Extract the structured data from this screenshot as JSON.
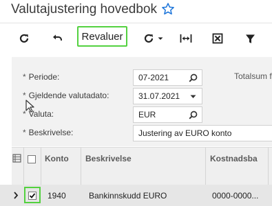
{
  "header": {
    "title": "Valutajustering hovedbok",
    "favorite_icon": "star-outline-icon"
  },
  "toolbar": {
    "refresh_icon": "refresh-icon",
    "undo_icon": "undo-icon",
    "revalue_label": "Revaluer",
    "actions_icon": "gear-refresh-icon",
    "fit_icon": "fit-columns-icon",
    "excel_icon": "export-excel-icon",
    "filter_icon": "filter-icon",
    "accent_color": "#53d13f"
  },
  "form": {
    "period": {
      "label": "Periode:",
      "value": "07-2021"
    },
    "rate_date": {
      "label": "Gjeldende valutadato:",
      "value": "31.07.2021"
    },
    "currency": {
      "label": "Valuta:",
      "value": "EUR"
    },
    "description": {
      "label": "Beskrivelse:",
      "value": "Justering av EURO konto"
    },
    "total_label": "Totalsum f",
    "required_mark": "*"
  },
  "grid": {
    "headers": {
      "account": "Konto",
      "description": "Beskrivelse",
      "cost_center": "Kostnadsba"
    },
    "rows": [
      {
        "account": "1940",
        "description": "Bankinnskudd EURO",
        "cost_center": "0000-0000...",
        "selected": true
      }
    ]
  }
}
